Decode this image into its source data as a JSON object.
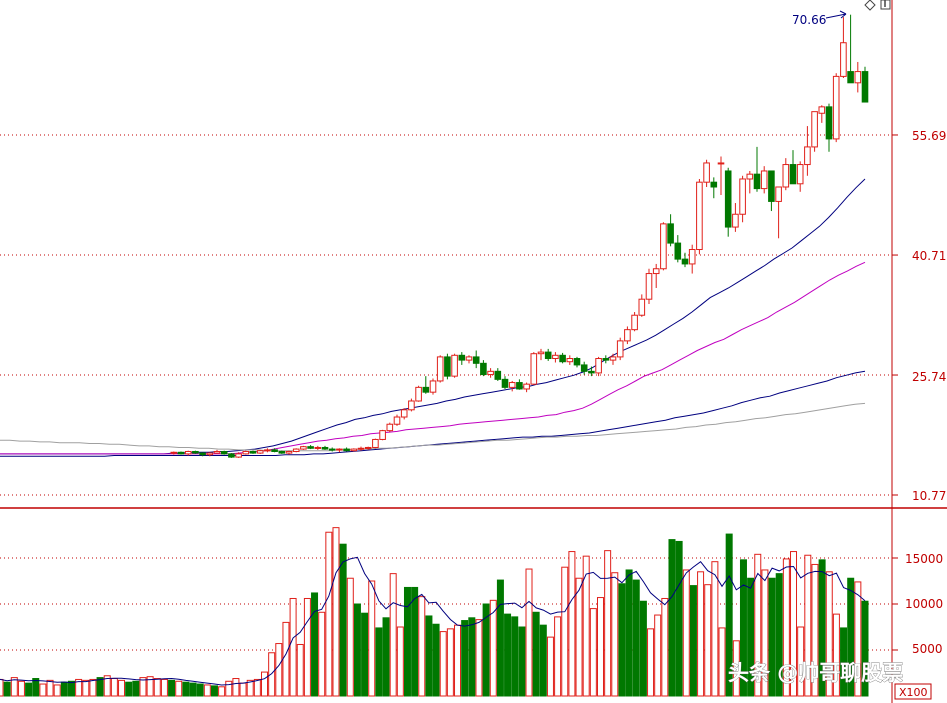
{
  "chart_data": {
    "type": "candlestick",
    "price_axis": {
      "ticks": [
        "55.69",
        "40.71",
        "25.74",
        "10.77"
      ],
      "tick_values": [
        55.69,
        40.71,
        25.74,
        10.77
      ],
      "range": [
        10.77,
        70.66
      ]
    },
    "peak_label": "70.66",
    "volume_axis": {
      "ticks": [
        "15000",
        "10000",
        "5000"
      ],
      "tick_values": [
        15000,
        10000,
        5000
      ],
      "range": [
        0,
        17500
      ]
    },
    "volume_unit": "X100",
    "candles": [
      [
        16.0,
        16.2,
        15.8,
        16.1
      ],
      [
        16.1,
        16.2,
        15.8,
        15.9
      ],
      [
        15.9,
        16.3,
        15.7,
        16.2
      ],
      [
        16.2,
        16.3,
        15.9,
        16.0
      ],
      [
        16.0,
        16.1,
        15.6,
        15.8
      ],
      [
        15.8,
        16.1,
        15.6,
        16.0
      ],
      [
        16.0,
        16.4,
        15.9,
        16.2
      ],
      [
        16.2,
        16.3,
        15.8,
        15.9
      ],
      [
        15.9,
        16.0,
        15.4,
        15.5
      ],
      [
        15.5,
        16.1,
        15.4,
        15.9
      ],
      [
        15.9,
        16.3,
        15.8,
        16.2
      ],
      [
        16.2,
        16.3,
        15.9,
        16.0
      ],
      [
        16.0,
        16.4,
        15.9,
        16.3
      ],
      [
        16.3,
        16.6,
        16.1,
        16.4
      ],
      [
        16.4,
        16.6,
        16.1,
        16.2
      ],
      [
        16.2,
        16.3,
        15.9,
        16.0
      ],
      [
        16.0,
        16.3,
        15.8,
        16.2
      ],
      [
        16.2,
        16.6,
        16.1,
        16.5
      ],
      [
        16.5,
        16.9,
        16.4,
        16.8
      ],
      [
        16.8,
        17.0,
        16.5,
        16.6
      ],
      [
        16.6,
        16.9,
        16.4,
        16.7
      ],
      [
        16.7,
        16.9,
        16.4,
        16.5
      ],
      [
        16.5,
        16.7,
        16.2,
        16.4
      ],
      [
        16.4,
        16.6,
        16.1,
        16.5
      ],
      [
        16.5,
        16.7,
        16.2,
        16.3
      ],
      [
        16.3,
        16.6,
        16.2,
        16.5
      ],
      [
        16.5,
        16.8,
        16.3,
        16.6
      ],
      [
        16.6,
        16.8,
        16.4,
        16.7
      ],
      [
        16.7,
        17.8,
        16.6,
        17.7
      ],
      [
        17.7,
        18.9,
        17.6,
        18.8
      ],
      [
        18.8,
        19.8,
        18.6,
        19.6
      ],
      [
        19.6,
        20.8,
        19.4,
        20.5
      ],
      [
        20.5,
        21.6,
        20.2,
        21.4
      ],
      [
        21.4,
        22.8,
        21.2,
        22.5
      ],
      [
        22.5,
        24.4,
        22.4,
        24.2
      ],
      [
        24.2,
        25.6,
        23.4,
        23.6
      ],
      [
        23.6,
        25.3,
        23.3,
        25.0
      ],
      [
        25.0,
        28.2,
        24.8,
        28.0
      ],
      [
        28.0,
        28.4,
        25.2,
        25.6
      ],
      [
        25.6,
        28.4,
        25.4,
        28.2
      ],
      [
        28.2,
        28.6,
        27.0,
        27.6
      ],
      [
        27.6,
        28.2,
        27.2,
        28.0
      ],
      [
        28.0,
        28.8,
        26.6,
        27.2
      ],
      [
        27.2,
        27.6,
        25.6,
        25.8
      ],
      [
        25.8,
        26.6,
        25.4,
        26.2
      ],
      [
        26.2,
        26.6,
        25.0,
        25.2
      ],
      [
        25.2,
        25.6,
        24.0,
        24.2
      ],
      [
        24.2,
        25.0,
        23.7,
        24.8
      ],
      [
        24.8,
        25.2,
        23.9,
        24.0
      ],
      [
        24.0,
        24.8,
        23.6,
        24.6
      ],
      [
        24.6,
        28.6,
        24.5,
        28.4
      ],
      [
        28.4,
        29.0,
        27.6,
        28.6
      ],
      [
        28.6,
        29.0,
        27.5,
        27.8
      ],
      [
        27.8,
        28.6,
        27.3,
        28.2
      ],
      [
        28.2,
        28.5,
        27.2,
        27.4
      ],
      [
        27.4,
        28.2,
        27.0,
        27.8
      ],
      [
        27.8,
        28.0,
        26.7,
        27.0
      ],
      [
        27.0,
        27.4,
        25.8,
        26.2
      ],
      [
        26.2,
        26.8,
        25.6,
        26.0
      ],
      [
        26.0,
        28.0,
        25.6,
        27.8
      ],
      [
        27.8,
        28.2,
        27.2,
        27.6
      ],
      [
        27.6,
        28.4,
        27.0,
        28.0
      ],
      [
        28.0,
        30.4,
        27.6,
        30.0
      ],
      [
        30.0,
        31.8,
        29.6,
        31.4
      ],
      [
        31.4,
        33.6,
        31.2,
        33.2
      ],
      [
        33.2,
        35.8,
        33.0,
        35.2
      ],
      [
        35.2,
        39.0,
        34.6,
        38.4
      ],
      [
        38.4,
        39.6,
        36.6,
        39.0
      ],
      [
        39.0,
        44.8,
        38.8,
        44.6
      ],
      [
        44.6,
        45.8,
        41.8,
        42.2
      ],
      [
        42.2,
        43.2,
        39.8,
        40.2
      ],
      [
        40.2,
        41.0,
        39.2,
        39.6
      ],
      [
        39.6,
        42.0,
        38.4,
        41.4
      ],
      [
        41.4,
        50.2,
        40.8,
        49.8
      ],
      [
        49.8,
        52.6,
        49.2,
        52.2
      ],
      [
        49.8,
        50.4,
        47.8,
        49.2
      ],
      [
        52.2,
        53.0,
        48.2,
        52.2
      ],
      [
        51.2,
        51.6,
        43.0,
        44.2
      ],
      [
        44.2,
        47.2,
        43.6,
        45.8
      ],
      [
        45.8,
        50.6,
        44.8,
        50.2
      ],
      [
        50.2,
        51.2,
        48.4,
        50.8
      ],
      [
        50.8,
        54.2,
        48.6,
        49.0
      ],
      [
        49.0,
        51.8,
        48.4,
        51.2
      ],
      [
        51.2,
        51.2,
        46.2,
        47.4
      ],
      [
        47.4,
        48.8,
        42.8,
        49.2
      ],
      [
        49.2,
        52.8,
        48.8,
        52.0
      ],
      [
        52.0,
        53.8,
        49.6,
        49.6
      ],
      [
        49.6,
        52.4,
        48.6,
        52.0
      ],
      [
        52.0,
        56.8,
        50.6,
        54.2
      ],
      [
        54.2,
        58.4,
        53.6,
        58.6
      ],
      [
        58.4,
        59.4,
        57.2,
        59.2
      ],
      [
        59.2,
        59.6,
        53.6,
        55.2
      ],
      [
        55.2,
        63.4,
        54.8,
        63.0
      ],
      [
        63.0,
        70.4,
        62.8,
        67.2
      ],
      [
        63.6,
        70.7,
        62.2,
        62.2
      ],
      [
        62.2,
        64.8,
        61.0,
        63.6
      ],
      [
        63.6,
        64.2,
        59.8,
        59.8
      ]
    ],
    "ma_lines": [
      {
        "color": "#00007f",
        "values": [
          15.9,
          15.9,
          15.9,
          15.9,
          15.9,
          15.9,
          15.9,
          15.9,
          15.9,
          15.9,
          15.9,
          15.9,
          15.9,
          15.9,
          15.9,
          15.9,
          15.9,
          15.9,
          15.9,
          16.0,
          16.0,
          16.1,
          16.1,
          16.1,
          16.2,
          16.2,
          16.3,
          16.4,
          16.5,
          16.7,
          16.9,
          17.2,
          17.5,
          17.9,
          18.3,
          18.7,
          19.1,
          19.5,
          19.8,
          20.2,
          20.4,
          20.7,
          20.9,
          21.2,
          21.4,
          21.6,
          21.8,
          22.0,
          22.2,
          22.5,
          22.7,
          23.0,
          23.2,
          23.4,
          23.6,
          23.8,
          24.0,
          24.2,
          24.3,
          24.6,
          24.8,
          25.1,
          25.4,
          25.7,
          26.1,
          26.6,
          27.3,
          28.0,
          28.6,
          29.1,
          29.6,
          30.1,
          30.7,
          31.4,
          32.1,
          32.8,
          33.6,
          34.5,
          35.4,
          36.0,
          36.6,
          37.3,
          38.0,
          38.7,
          39.4,
          40.2,
          40.9,
          41.6,
          42.5,
          43.4,
          44.3,
          45.4,
          46.6,
          47.9,
          49.1,
          50.2
        ]
      },
      {
        "color": "#c000c0",
        "values": [
          15.9,
          15.9,
          15.9,
          15.9,
          15.9,
          15.9,
          15.9,
          15.9,
          15.9,
          15.9,
          15.9,
          15.9,
          15.9,
          15.9,
          15.9,
          15.9,
          15.9,
          15.9,
          15.9,
          15.9,
          15.9,
          15.9,
          15.9,
          15.9,
          15.9,
          15.9,
          15.9,
          16.0,
          16.1,
          16.2,
          16.3,
          16.5,
          16.7,
          16.9,
          17.1,
          17.3,
          17.5,
          17.6,
          17.8,
          17.9,
          18.1,
          18.2,
          18.4,
          18.5,
          18.6,
          18.7,
          18.9,
          19.0,
          19.1,
          19.2,
          19.3,
          19.4,
          19.6,
          19.7,
          19.8,
          19.9,
          20.0,
          20.1,
          20.2,
          20.3,
          20.4,
          20.5,
          20.7,
          20.8,
          21.1,
          21.3,
          21.6,
          22.1,
          22.7,
          23.3,
          23.9,
          24.4,
          25.0,
          25.6,
          26.0,
          26.4,
          27.0,
          27.6,
          28.2,
          28.8,
          29.3,
          29.8,
          30.2,
          30.8,
          31.4,
          31.9,
          32.4,
          32.9,
          33.6,
          34.2,
          34.8,
          35.5,
          36.2,
          36.9,
          37.6,
          38.2,
          38.7,
          39.3,
          39.8
        ]
      },
      {
        "color": "#00007f",
        "values": [
          15.6,
          15.6,
          15.6,
          15.6,
          15.6,
          15.6,
          15.6,
          15.6,
          15.6,
          15.6,
          15.6,
          15.6,
          15.7,
          15.7,
          15.7,
          15.7,
          15.7,
          15.7,
          15.7,
          15.7,
          15.7,
          15.7,
          15.7,
          15.7,
          15.7,
          15.7,
          15.7,
          15.7,
          15.7,
          15.7,
          15.8,
          15.8,
          15.8,
          15.9,
          15.9,
          16.0,
          16.1,
          16.2,
          16.3,
          16.4,
          16.5,
          16.6,
          16.7,
          16.8,
          16.9,
          17.0,
          17.1,
          17.2,
          17.3,
          17.4,
          17.5,
          17.6,
          17.7,
          17.8,
          17.9,
          18.0,
          18.0,
          18.1,
          18.1,
          18.2,
          18.3,
          18.4,
          18.5,
          18.7,
          18.9,
          19.1,
          19.3,
          19.5,
          19.7,
          19.9,
          20.1,
          20.4,
          20.6,
          20.8,
          21.0,
          21.3,
          21.6,
          21.9,
          22.3,
          22.6,
          22.9,
          23.1,
          23.5,
          23.8,
          24.1,
          24.4,
          24.7,
          25.0,
          25.4,
          25.7,
          26.0,
          26.2
        ]
      },
      {
        "color": "#a0a0a0",
        "values": [
          17.6,
          17.6,
          17.5,
          17.5,
          17.4,
          17.4,
          17.3,
          17.3,
          17.3,
          17.2,
          17.2,
          17.1,
          17.1,
          17.0,
          16.9,
          16.9,
          16.8,
          16.8,
          16.7,
          16.7,
          16.6,
          16.6,
          16.5,
          16.5,
          16.4,
          16.4,
          16.4,
          16.3,
          16.3,
          16.3,
          16.3,
          16.3,
          16.3,
          16.3,
          16.4,
          16.4,
          16.5,
          16.5,
          16.6,
          16.6,
          16.7,
          16.8,
          16.9,
          17.0,
          17.0,
          17.1,
          17.2,
          17.3,
          17.4,
          17.5,
          17.6,
          17.6,
          17.7,
          17.8,
          17.9,
          18.0,
          18.0,
          18.1,
          18.1,
          18.2,
          18.2,
          18.3,
          18.4,
          18.5,
          18.6,
          18.7,
          18.8,
          18.9,
          19.0,
          19.2,
          19.3,
          19.5,
          19.6,
          19.8,
          19.9,
          20.1,
          20.3,
          20.4,
          20.6,
          20.8,
          20.9,
          21.1,
          21.3,
          21.5,
          21.7,
          21.9,
          22.1,
          22.2
        ]
      }
    ],
    "volumes": [
      1800,
      1500,
      2000,
      1600,
      1400,
      1900,
      1300,
      1700,
      1200,
      1500,
      1600,
      1800,
      1700,
      1800,
      2000,
      2200,
      1900,
      1700,
      1500,
      1600,
      2000,
      2100,
      1900,
      1800,
      1700,
      1600,
      1500,
      1400,
      1300,
      1200,
      1100,
      1000,
      1600,
      1900,
      1400,
      1700,
      1800,
      2600,
      4700,
      5700,
      8000,
      10600,
      5600,
      10600,
      11200,
      9100,
      17800,
      18300,
      16500,
      12800,
      10000,
      9000,
      12500,
      7400,
      8500,
      13300,
      7500,
      11800,
      11800,
      10800,
      8700,
      7800,
      7000,
      7300,
      7700,
      8200,
      8500,
      8300,
      10000,
      10400,
      12600,
      8900,
      8600,
      7500,
      13800,
      9100,
      7700,
      6400,
      8600,
      14000,
      15700,
      12800,
      15200,
      9500,
      10700,
      15800,
      13400,
      12200,
      13700,
      12600,
      10300,
      7300,
      8800,
      10600,
      17000,
      16800,
      13700,
      12000,
      13500,
      12100,
      14600,
      7400,
      17600,
      6000,
      14800,
      12800,
      15400,
      13700,
      12800,
      13300,
      14900,
      15700,
      7500,
      15300,
      14300,
      14800,
      13500,
      8900,
      7400,
      12800,
      12400,
      10300
    ]
  }
}
